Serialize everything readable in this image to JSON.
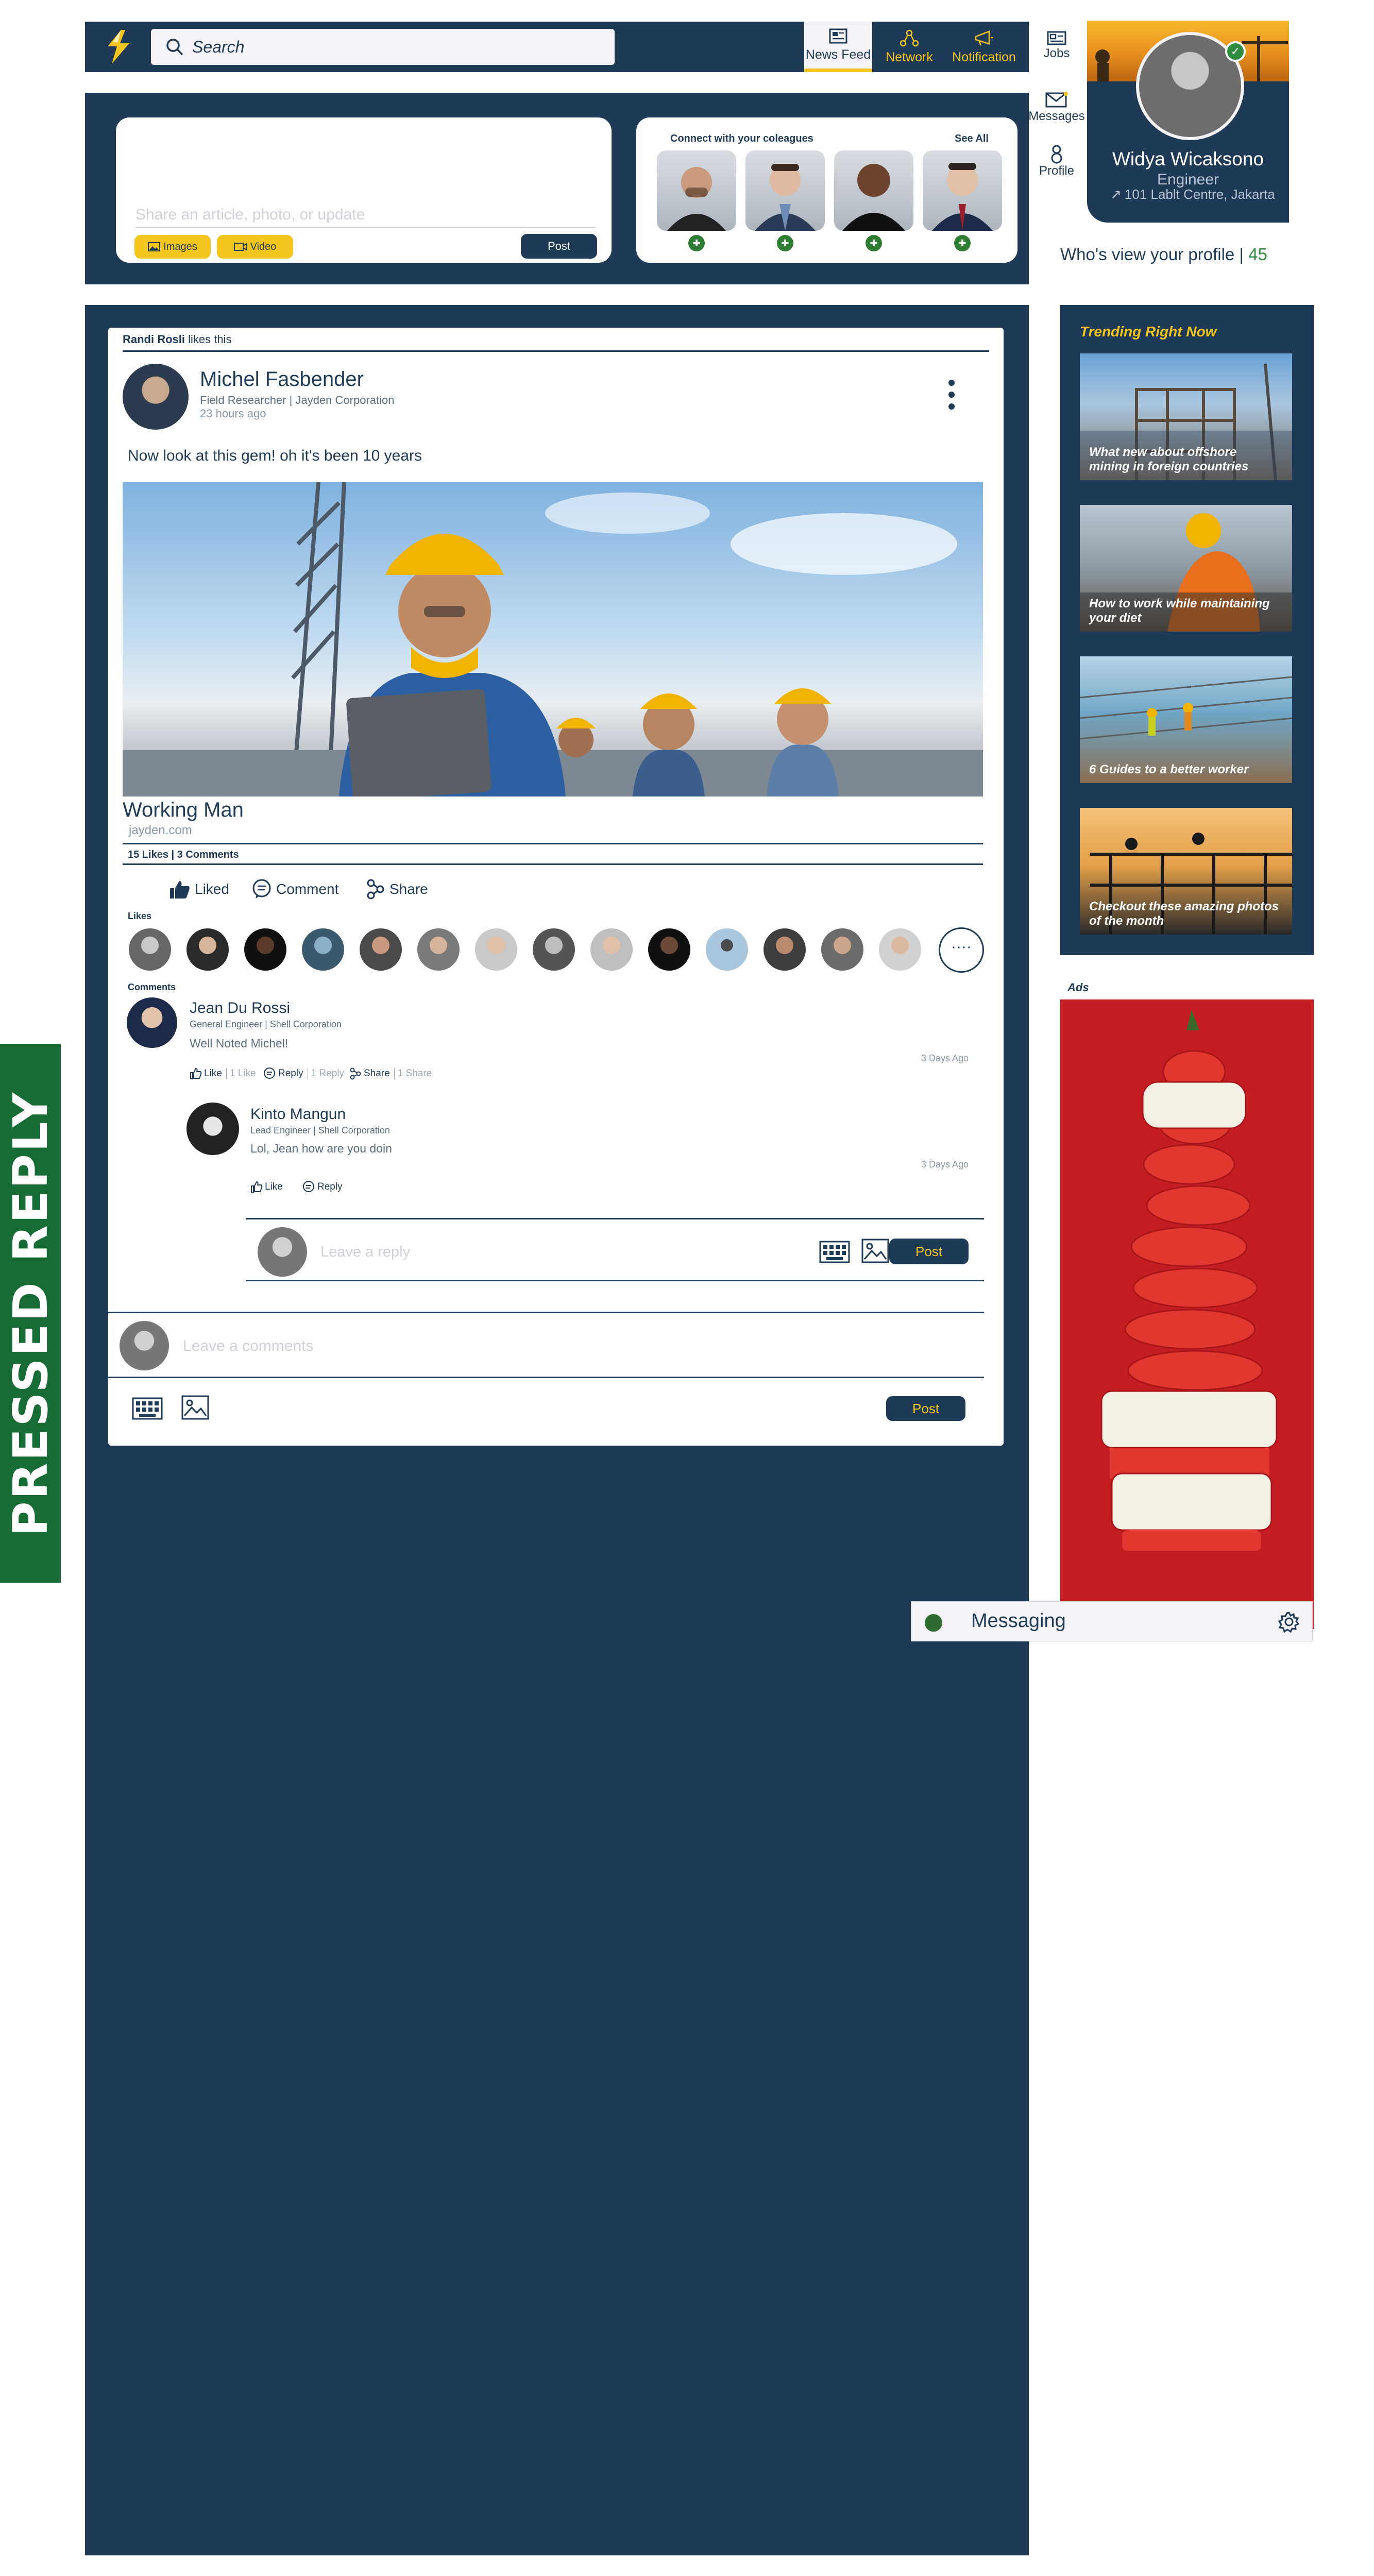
{
  "header": {
    "search_placeholder": "Search",
    "nav": [
      {
        "label": "News Feed",
        "icon": "newspaper-icon",
        "active": true
      },
      {
        "label": "Network",
        "icon": "network-icon",
        "active": false
      },
      {
        "label": "Notification",
        "icon": "megaphone-icon",
        "active": false
      }
    ]
  },
  "side_nav": [
    {
      "label": "Jobs",
      "icon": "briefcase-icon"
    },
    {
      "label": "Messages",
      "icon": "envelope-icon"
    },
    {
      "label": "Profile",
      "icon": "person-icon"
    }
  ],
  "profile": {
    "name": "Widya Wicaksono",
    "role": "Engineer",
    "location": "101 Lablt Centre, Jakarta",
    "views_label": "Who's view your profile",
    "views_count": "45"
  },
  "composer": {
    "placeholder": "Share an article, photo, or update",
    "images_label": "Images",
    "video_label": "Video",
    "post_label": "Post"
  },
  "connect": {
    "title": "Connect with your coleagues",
    "see_all": "See All"
  },
  "post": {
    "liker_name": "Randi Rosli",
    "liker_suffix": " likes this",
    "author_name": "Michel Fasbender",
    "author_subtitle": "Field Researcher | Jayden Corporation",
    "time": "23 hours ago",
    "text": "Now look at this gem! oh it's been 10 years",
    "link_title": "Working Man",
    "link_url": "jayden.com",
    "stats": "15 Likes | 3 Comments",
    "actions": {
      "liked": "Liked",
      "comment": "Comment",
      "share": "Share"
    },
    "likes_label": "Likes",
    "more_likers": "····",
    "comments_label": "Comments"
  },
  "comments": [
    {
      "name": "Jean Du Rossi",
      "role": "General Engineer | Shell Corporation",
      "text": "Well Noted Michel!",
      "time": "3 Days Ago",
      "like": "Like",
      "like_count": "1 Like",
      "reply": "Reply",
      "reply_count": "1 Reply",
      "share": "Share",
      "share_count": "1 Share"
    },
    {
      "name": "Kinto Mangun",
      "role": "Lead Engineer | Shell Corporation",
      "text": "Lol, Jean how are you doin",
      "time": "3 Days Ago",
      "like": "Like",
      "reply": "Reply"
    }
  ],
  "reply_box": {
    "placeholder": "Leave a reply",
    "post_label": "Post"
  },
  "comment_box": {
    "placeholder": "Leave a comments",
    "post_label": "Post"
  },
  "trending": {
    "title": "Trending Right Now",
    "items": [
      "What new about offshore mining in foreign countries",
      "How to work while maintaining your diet",
      "6 Guides to a better worker",
      "Checkout these amazing photos of the month"
    ]
  },
  "ads": {
    "label": "Ads"
  },
  "messaging": {
    "label": "Messaging"
  },
  "pressed_reply": "PRESSED REPLY",
  "colors": {
    "navy": "#1f3a56",
    "yellow": "#f4c51c",
    "green": "#2e8b3e",
    "ad_red": "#c41e22"
  }
}
